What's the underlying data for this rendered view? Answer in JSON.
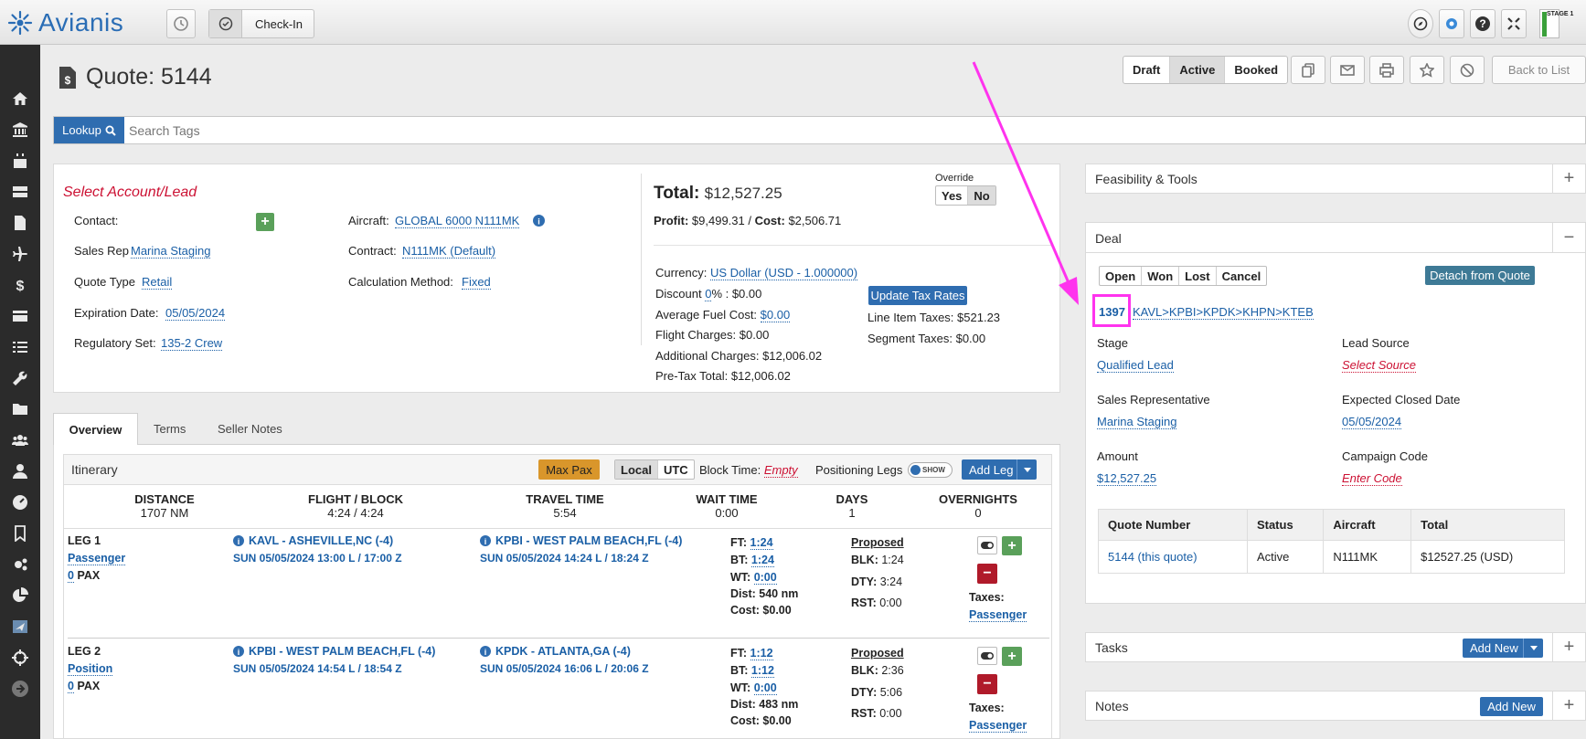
{
  "topbar": {
    "app_name": "Avianis",
    "checkin_label": "Check-In",
    "stage_label": "STAGE 1"
  },
  "sidebar": {
    "icons": [
      "home-icon",
      "bank-icon",
      "calendar-icon",
      "server-icon",
      "document-icon",
      "plane-icon",
      "dollar-icon",
      "card-icon",
      "list-icon",
      "wrench-icon",
      "folder-icon",
      "users-icon",
      "user-icon",
      "dashboard-icon",
      "bookmark-icon",
      "gears-icon",
      "pie-chart-icon",
      "plane-screen-icon",
      "crosshair-icon",
      "arrow-right-icon"
    ]
  },
  "header": {
    "title": "Quote: 5144",
    "status_buttons": [
      "Draft",
      "Active",
      "Booked"
    ],
    "active_status": "Active",
    "back_label": "Back to List"
  },
  "lookup": {
    "button_label": "Lookup",
    "placeholder": "Search Tags"
  },
  "quote": {
    "select_account": "Select Account/Lead",
    "contact_label": "Contact:",
    "sales_rep_label": "Sales Rep",
    "sales_rep_value": "Marina Staging",
    "quote_type_label": "Quote Type",
    "quote_type_value": "Retail",
    "expiration_label": "Expiration Date:",
    "expiration_value": "05/05/2024",
    "regulatory_label": "Regulatory Set:",
    "regulatory_value": "135-2 Crew",
    "aircraft_label": "Aircraft:",
    "aircraft_value": "GLOBAL 6000 N111MK",
    "contract_label": "Contract:",
    "contract_value": "N111MK (Default)",
    "calc_label": "Calculation Method:",
    "calc_value": "Fixed"
  },
  "totals": {
    "total_label": "Total:",
    "total_value": "$12,527.25",
    "profit_label": "Profit:",
    "profit_value": "$9,499.31",
    "cost_label": "Cost:",
    "cost_value": "$2,506.71",
    "override_label": "Override",
    "override_yes": "Yes",
    "override_no": "No",
    "currency_label": "Currency:",
    "currency_value": "US Dollar (USD - 1.000000)",
    "discount_label": "Discount",
    "discount_pct": "0",
    "discount_rest": "% : $0.00",
    "fuel_label": "Average Fuel Cost:",
    "fuel_value": "$0.00",
    "flight_charges": "Flight Charges: $0.00",
    "additional_charges": "Additional Charges: $12,006.02",
    "pretax_total": "Pre-Tax Total: $12,006.02",
    "update_tax_label": "Update Tax Rates",
    "line_item_taxes": "Line Item Taxes: $521.23",
    "segment_taxes": "Segment Taxes: $0.00"
  },
  "tabs": [
    {
      "label": "Overview"
    },
    {
      "label": "Terms"
    },
    {
      "label": "Seller Notes"
    }
  ],
  "itinerary": {
    "title": "Itinerary",
    "max_pax": "Max Pax",
    "local": "Local",
    "utc": "UTC",
    "block_time_label": "Block Time:",
    "block_time_value": "Empty",
    "positioning_label": "Positioning Legs",
    "toggle_label": "SHOW",
    "add_leg": "Add Leg",
    "summary": [
      {
        "label": "DISTANCE",
        "value": "1707 NM"
      },
      {
        "label": "FLIGHT / BLOCK",
        "value": "4:24 / 4:24"
      },
      {
        "label": "TRAVEL TIME",
        "value": "5:54"
      },
      {
        "label": "WAIT TIME",
        "value": "0:00"
      },
      {
        "label": "DAYS",
        "value": "1"
      },
      {
        "label": "OVERNIGHTS",
        "value": "0"
      }
    ],
    "legs": [
      {
        "leg": "LEG 1",
        "type": "Passenger",
        "pax_num": "0",
        "pax_label": "PAX",
        "dep": "KAVL - ASHEVILLE,NC (-4)",
        "dep_time": "SUN 05/05/2024 13:00 L / 17:00 Z",
        "arr": "KPBI - WEST PALM BEACH,FL (-4)",
        "arr_time": "SUN 05/05/2024 14:24 L / 18:24 Z",
        "ft": "1:24",
        "bt": "1:24",
        "wt": "0:00",
        "dist": "540 nm",
        "cost": "$0.00",
        "proposed": "Proposed",
        "blk": "1:24",
        "dty": "3:24",
        "rst": "0:00",
        "taxes_label": "Taxes:",
        "taxes_value": "Passenger"
      },
      {
        "leg": "LEG 2",
        "type": "Position",
        "pax_num": "0",
        "pax_label": "PAX",
        "dep": "KPBI - WEST PALM BEACH,FL (-4)",
        "dep_time": "SUN 05/05/2024 14:54 L / 18:54 Z",
        "arr": "KPDK - ATLANTA,GA (-4)",
        "arr_time": "SUN 05/05/2024 16:06 L / 20:06 Z",
        "ft": "1:12",
        "bt": "1:12",
        "wt": "0:00",
        "dist": "483 nm",
        "cost": "$0.00",
        "proposed": "Proposed",
        "blk": "2:36",
        "dty": "5:06",
        "rst": "0:00",
        "taxes_label": "Taxes:",
        "taxes_value": "Passenger"
      }
    ]
  },
  "feasibility": {
    "title": "Feasibility & Tools"
  },
  "deal": {
    "title": "Deal",
    "buttons": [
      "Open",
      "Won",
      "Lost",
      "Cancel"
    ],
    "detach_label": "Detach from Quote",
    "deal_id": "1397",
    "route": "KAVL>KPBI>KPDK>KHPN>KTEB",
    "stage_label": "Stage",
    "stage_value": "Qualified Lead",
    "lead_source_label": "Lead Source",
    "lead_source_value": "Select Source",
    "sales_rep_label": "Sales Representative",
    "sales_rep_value": "Marina Staging",
    "closed_date_label": "Expected Closed Date",
    "closed_date_value": "05/05/2024",
    "amount_label": "Amount",
    "amount_value": "$12,527.25",
    "campaign_label": "Campaign Code",
    "campaign_value": "Enter Code",
    "table_headers": [
      "Quote Number",
      "Status",
      "Aircraft",
      "Total"
    ],
    "table_rows": [
      [
        "5144 (this quote)",
        "Active",
        "N111MK",
        "$12527.25 (USD)"
      ]
    ]
  },
  "tasks": {
    "title": "Tasks",
    "add_label": "Add New"
  },
  "notes": {
    "title": "Notes",
    "add_label": "Add New"
  },
  "colors": {
    "brand_blue": "#2f6db0",
    "annotation_magenta": "#ff33ee",
    "required_red": "#cc1133"
  }
}
